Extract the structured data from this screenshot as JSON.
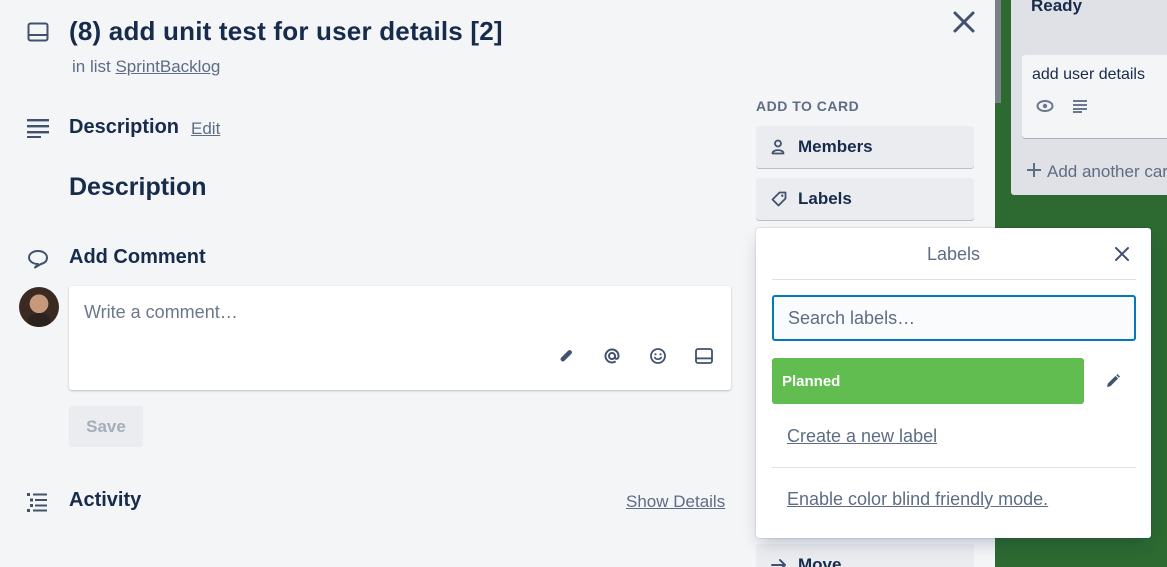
{
  "board": {
    "list_title": "Ready",
    "card_title": "add user details",
    "add_card_label": "Add another card"
  },
  "card": {
    "title": "(8) add unit test for user details [2]",
    "in_list_prefix": "in list",
    "list_name": "SprintBacklog"
  },
  "description": {
    "heading": "Description",
    "edit_label": "Edit",
    "body": "Description"
  },
  "comment": {
    "heading": "Add Comment",
    "placeholder": "Write a comment…",
    "save_label": "Save"
  },
  "activity": {
    "heading": "Activity",
    "show_details_label": "Show Details"
  },
  "sidebar": {
    "section_title": "ADD TO CARD",
    "members_label": "Members",
    "labels_label": "Labels",
    "move_label": "Move"
  },
  "labels_popover": {
    "title": "Labels",
    "search_placeholder": "Search labels…",
    "labels": [
      {
        "name": "Planned",
        "color": "#61bd4f"
      }
    ],
    "create_label": "Create a new label",
    "colorblind_label": "Enable color blind friendly mode."
  },
  "colors": {
    "accent_blue": "#0079bf",
    "label_green": "#61bd4f",
    "board_green": "#2c6a31"
  }
}
